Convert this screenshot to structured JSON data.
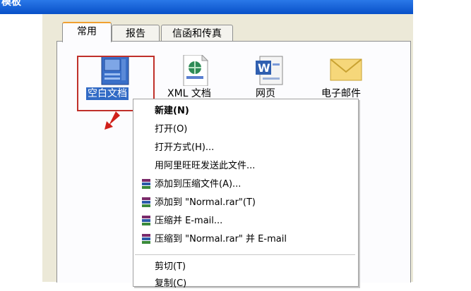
{
  "window": {
    "title": "模板"
  },
  "tabs": [
    {
      "label": "常用",
      "active": true
    },
    {
      "label": "报告",
      "active": false
    },
    {
      "label": "信函和传真",
      "active": false
    }
  ],
  "icons": [
    {
      "label": "空白文档",
      "icon": "blank-document-icon",
      "selected": true
    },
    {
      "label": "XML 文档",
      "icon": "xml-document-icon",
      "selected": false
    },
    {
      "label": "网页",
      "icon": "word-web-page-icon",
      "selected": false
    },
    {
      "label": "电子邮件",
      "icon": "email-envelope-icon",
      "selected": false
    }
  ],
  "context_menu": {
    "items": [
      {
        "label": "新建(N)",
        "bold": true
      },
      {
        "label": "打开(O)"
      },
      {
        "label": "打开方式(H)..."
      },
      {
        "label": "用阿里旺旺发送此文件..."
      },
      {
        "label": "添加到压缩文件(A)...",
        "icon": "winrar-icon"
      },
      {
        "label": "添加到 \"Normal.rar\"(T)",
        "icon": "winrar-icon"
      },
      {
        "label": "压缩并 E-mail...",
        "icon": "winrar-icon"
      },
      {
        "label": "压缩到 \"Normal.rar\" 并 E-mail",
        "icon": "winrar-icon"
      },
      {
        "label": "剪切(T)"
      },
      {
        "label": "复制(C)"
      }
    ]
  },
  "colors": {
    "selection": "#316ac5",
    "highlight_box": "#c0302a",
    "titlebar": "#0850c8",
    "dialog_bg": "#ece9d8"
  }
}
